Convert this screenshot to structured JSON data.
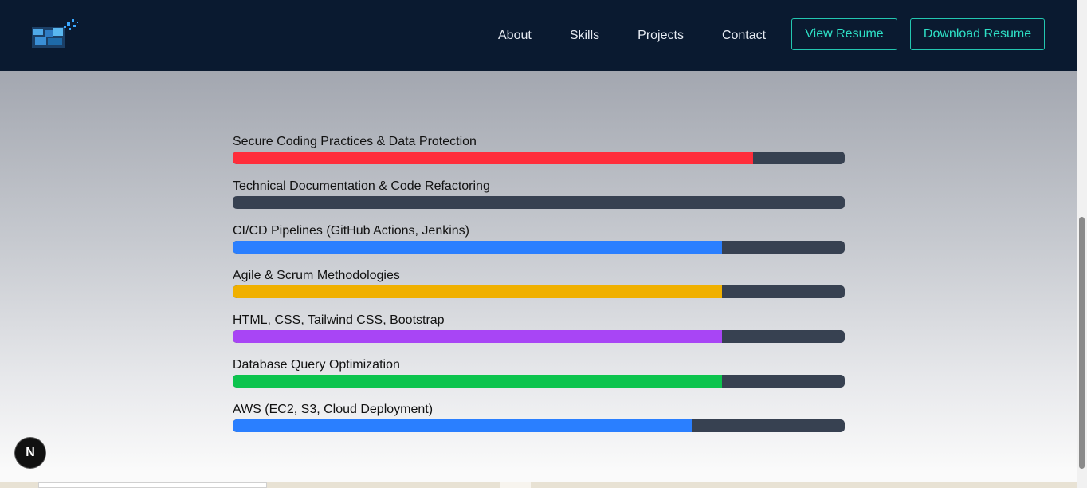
{
  "nav": {
    "links": [
      "About",
      "Skills",
      "Projects",
      "Contact"
    ],
    "view_resume": "View Resume",
    "download_resume": "Download Resume"
  },
  "skills": [
    {
      "name": "Secure Coding Practices & Data Protection",
      "percent": 85,
      "color": "#ff2d3b"
    },
    {
      "name": "Technical Documentation & Code Refactoring",
      "percent": 0,
      "color": "#374151"
    },
    {
      "name": "CI/CD Pipelines (GitHub Actions, Jenkins)",
      "percent": 80,
      "color": "#2a7fff"
    },
    {
      "name": "Agile & Scrum Methodologies",
      "percent": 80,
      "color": "#f0b000"
    },
    {
      "name": "HTML, CSS, Tailwind CSS, Bootstrap",
      "percent": 80,
      "color": "#a845f5"
    },
    {
      "name": "Database Query Optimization",
      "percent": 80,
      "color": "#0cc44e"
    },
    {
      "name": "AWS (EC2, S3, Cloud Deployment)",
      "percent": 75,
      "color": "#2a7fff"
    }
  ],
  "badge": "N"
}
